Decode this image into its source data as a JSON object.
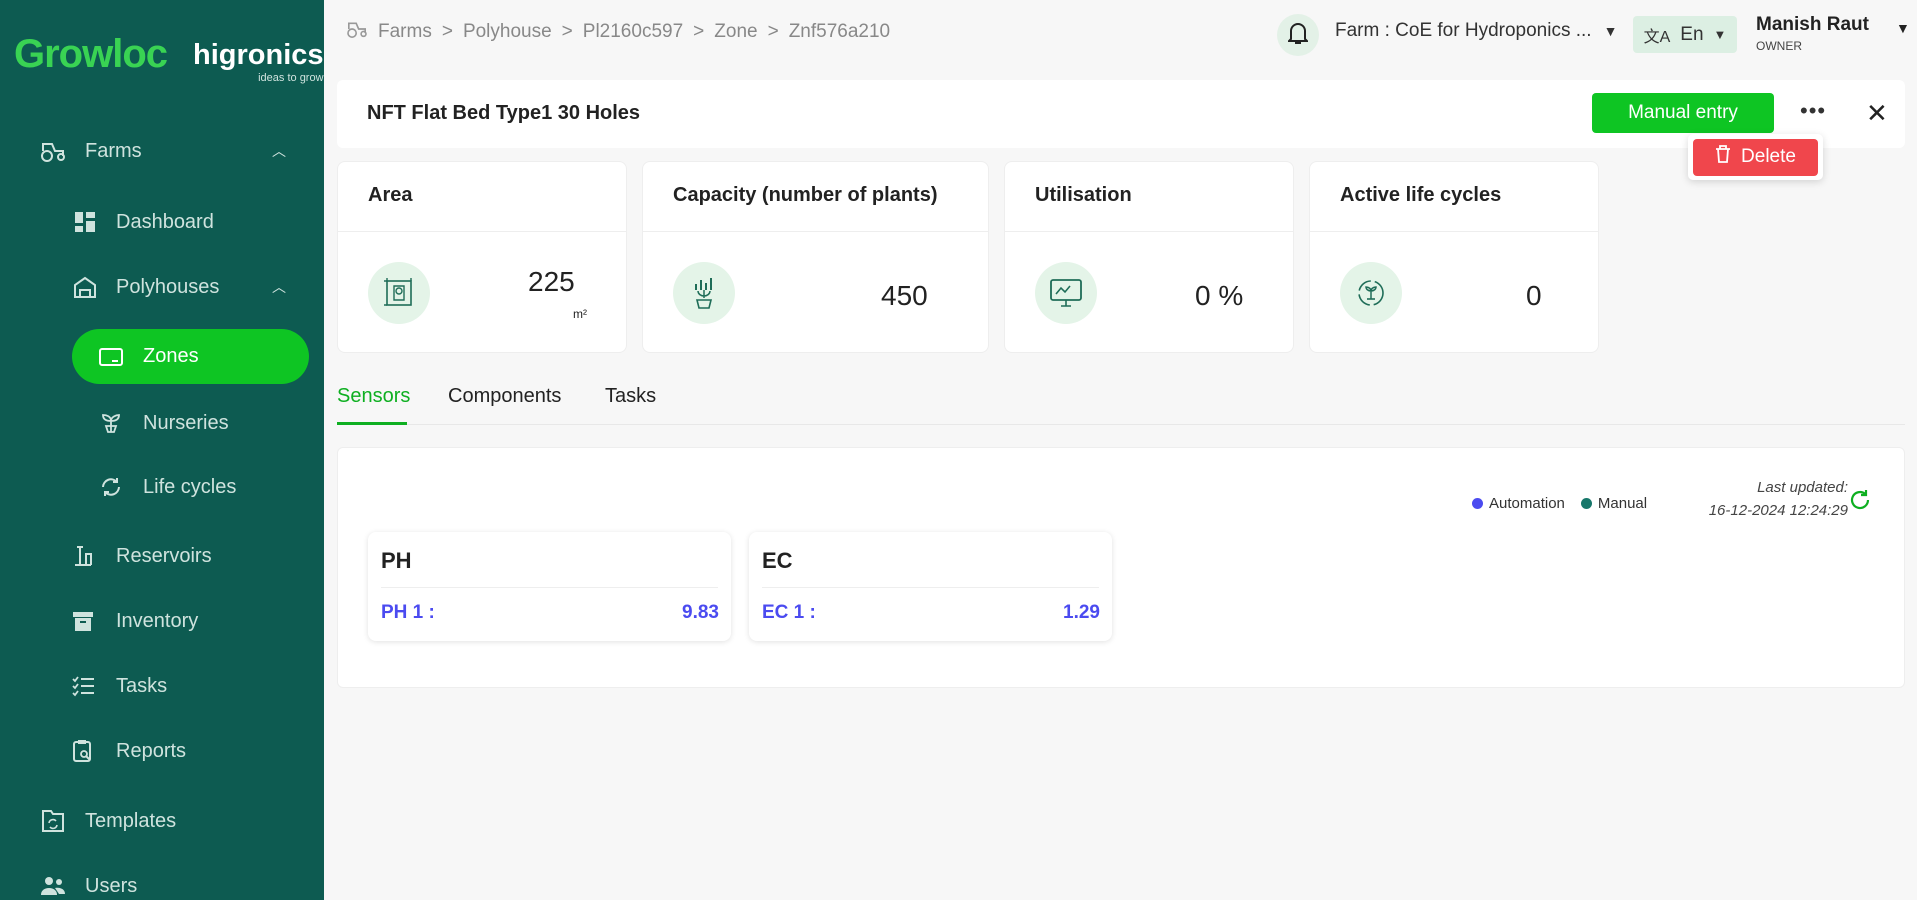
{
  "logo": {
    "growloc": "Growloc",
    "higronics": "higronics",
    "tagline": "ideas to grow"
  },
  "sidebar": {
    "items": [
      {
        "label": "Farms",
        "icon": "tractor-icon"
      },
      {
        "label": "Dashboard",
        "icon": "dashboard-icon"
      },
      {
        "label": "Polyhouses",
        "icon": "polyhouse-icon"
      },
      {
        "label": "Zones",
        "icon": "zone-icon"
      },
      {
        "label": "Nurseries",
        "icon": "seedling-icon"
      },
      {
        "label": "Life cycles",
        "icon": "cycle-icon"
      },
      {
        "label": "Reservoirs",
        "icon": "reservoir-icon"
      },
      {
        "label": "Inventory",
        "icon": "archive-icon"
      },
      {
        "label": "Tasks",
        "icon": "tasks-icon"
      },
      {
        "label": "Reports",
        "icon": "reports-icon"
      },
      {
        "label": "Templates",
        "icon": "templates-icon"
      },
      {
        "label": "Users",
        "icon": "users-icon"
      }
    ]
  },
  "breadcrumb": {
    "items": [
      "Farms",
      "Polyhouse",
      "Pl2160c597",
      "Zone",
      "Znf576a210"
    ],
    "sep": ">"
  },
  "header": {
    "farm": "Farm : CoE for Hydroponics ...",
    "lang": "En",
    "user_name": "Manish Raut",
    "user_role": "OWNER"
  },
  "title": {
    "text": "NFT Flat Bed Type1 30 Holes",
    "manual_entry": "Manual entry",
    "delete": "Delete"
  },
  "cards": [
    {
      "title": "Area",
      "value": "225",
      "unit": "m²"
    },
    {
      "title": "Capacity (number of plants)",
      "value": "450"
    },
    {
      "title": "Utilisation",
      "value": "0 %"
    },
    {
      "title": "Active life cycles",
      "value": "0"
    }
  ],
  "tabs": [
    "Sensors",
    "Components",
    "Tasks"
  ],
  "sensors": {
    "legend": {
      "automation": "Automation",
      "manual": "Manual"
    },
    "last_updated_label": "Last updated:",
    "last_updated": "16-12-2024 12:24:29",
    "items": [
      {
        "title": "PH",
        "key": "PH 1 :",
        "value": "9.83"
      },
      {
        "title": "EC",
        "key": "EC 1 :",
        "value": "1.29"
      }
    ]
  },
  "colors": {
    "sidebar": "#0d5b51",
    "accent": "#0ec523",
    "danger": "#f0464c",
    "sensor_value": "#4b4bf0",
    "automation": "#4b4bf0",
    "manual": "#17776a"
  }
}
